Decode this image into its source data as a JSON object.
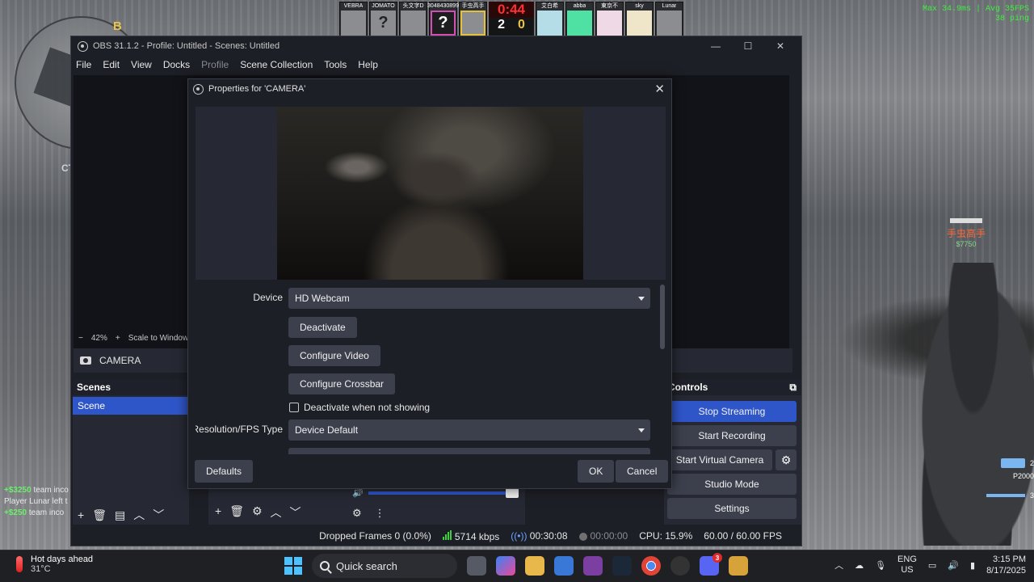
{
  "game": {
    "minimap": {
      "bombsite": "B",
      "spawn": "CT"
    },
    "hud_names": [
      "VEBRA",
      "JOMATO",
      "头文字D",
      "3048430899",
      "手虫高手",
      "艾白希",
      "abba",
      "東京不",
      "sky",
      "Lunar"
    ],
    "hud_unknown": "?",
    "timer": "0:44",
    "score_ct": "2",
    "score_t": "0",
    "perf_line1": "Max 34.9ms | Avg  35FPS",
    "perf_line2": "38 ping",
    "killfeed": [
      {
        "money": "+$3250",
        "text": "team inco"
      },
      {
        "money": "",
        "text": "Player Lunar left t"
      },
      {
        "money": "+$250",
        "text": "team inco"
      }
    ],
    "enemy_name": "手虫高手",
    "enemy_money": "$7750",
    "weapon_slot_2": "2",
    "weapon_name": "P2000",
    "weapon_slot_3": "3"
  },
  "obs": {
    "title": "OBS 31.1.2 - Profile: Untitled - Scenes: Untitled",
    "window_controls": {
      "minimize": "—",
      "maximize": "☐",
      "close": "✕"
    },
    "menu": [
      "File",
      "Edit",
      "View",
      "Docks",
      "Profile",
      "Scene Collection",
      "Tools",
      "Help"
    ],
    "zoom": "42%",
    "zoom_minus": "−",
    "zoom_plus": "+",
    "scale_label": "Scale to Window",
    "source_name": "CAMERA",
    "scenes_title": "Scenes",
    "scenes": [
      "Scene"
    ],
    "controls_title": "Controls",
    "controls": {
      "stop_streaming": "Stop Streaming",
      "start_recording": "Start Recording",
      "start_virtual_camera": "Start Virtual Camera",
      "studio_mode": "Studio Mode",
      "settings": "Settings"
    },
    "status": {
      "dropped_frames": "Dropped Frames 0 (0.0%)",
      "bitrate": "5714 kbps",
      "stream_time": "00:30:08",
      "record_time": "00:00:00",
      "cpu": "CPU: 15.9%",
      "fps": "60.00 / 60.00 FPS"
    },
    "volume_level": 1.0
  },
  "dialog": {
    "title": "Properties for 'CAMERA'",
    "close": "✕",
    "device_label": "Device",
    "device_value": "HD Webcam",
    "deactivate": "Deactivate",
    "configure_video": "Configure Video",
    "configure_crossbar": "Configure Crossbar",
    "deactivate_when_hidden": "Deactivate when not showing",
    "deactivate_when_hidden_checked": false,
    "res_label": "Resolution/FPS Type",
    "res_value": "Device Default",
    "defaults": "Defaults",
    "ok": "OK",
    "cancel": "Cancel"
  },
  "taskbar": {
    "weather_title": "Hot days ahead",
    "weather_temp": "31°C",
    "search": "Quick search",
    "apps": [
      "copilot-icon",
      "task-view-icon",
      "ms-copilot-app-icon",
      "file-explorer-icon",
      "store-icon",
      "app-icon",
      "steam-icon",
      "chrome-icon",
      "obs-icon",
      "discord-icon",
      "cs2-icon"
    ],
    "discord_badge": "3",
    "lang1": "ENG",
    "lang2": "US",
    "time": "3:15 PM",
    "date": "8/17/2025"
  }
}
